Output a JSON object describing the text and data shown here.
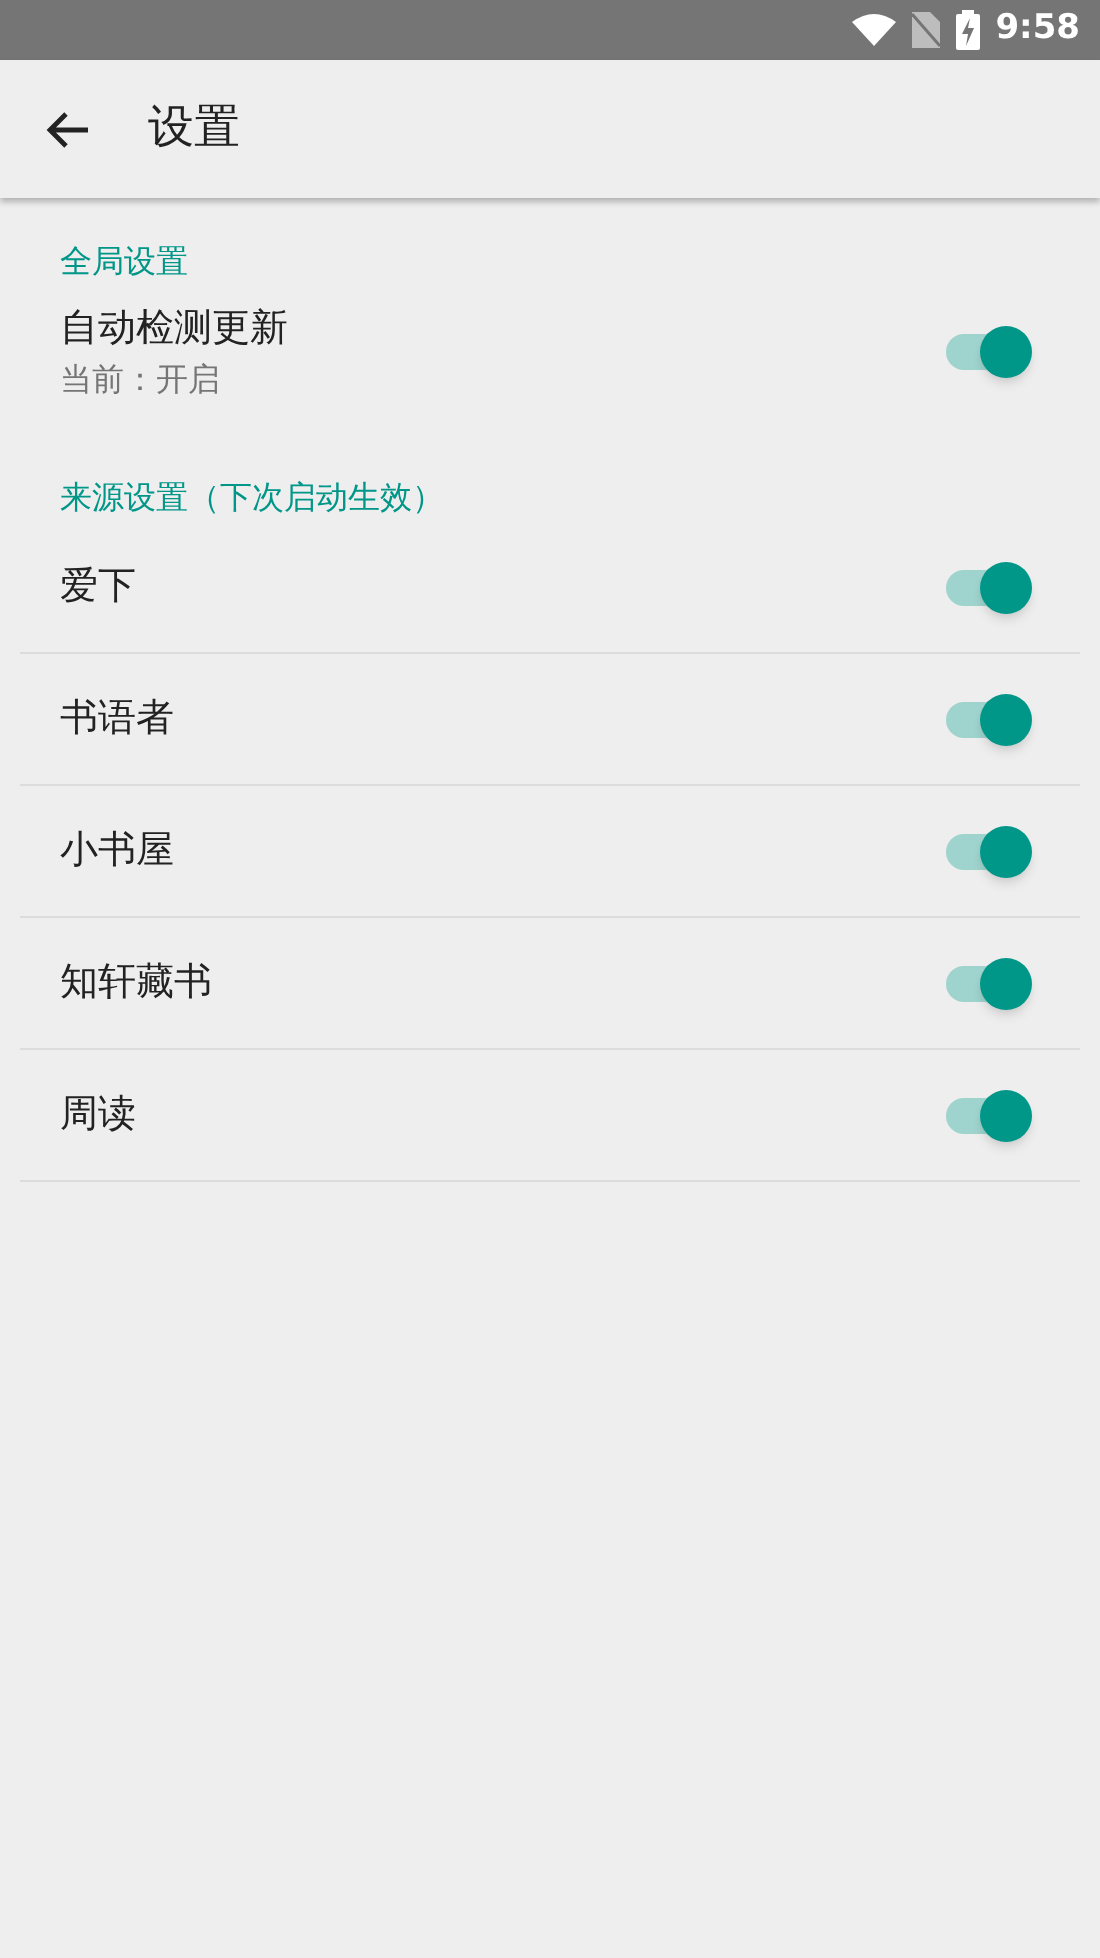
{
  "status_bar": {
    "time": "9:58"
  },
  "toolbar": {
    "title": "设置"
  },
  "sections": [
    {
      "header": "全局设置",
      "items": [
        {
          "title": "自动检测更新",
          "summary": "当前：开启",
          "on": true
        }
      ]
    },
    {
      "header": "来源设置（下次启动生效）",
      "items": [
        {
          "title": "爱下",
          "on": true
        },
        {
          "title": "书语者",
          "on": true
        },
        {
          "title": "小书屋",
          "on": true
        },
        {
          "title": "知轩藏书",
          "on": true
        },
        {
          "title": "周读",
          "on": true
        }
      ]
    }
  ]
}
